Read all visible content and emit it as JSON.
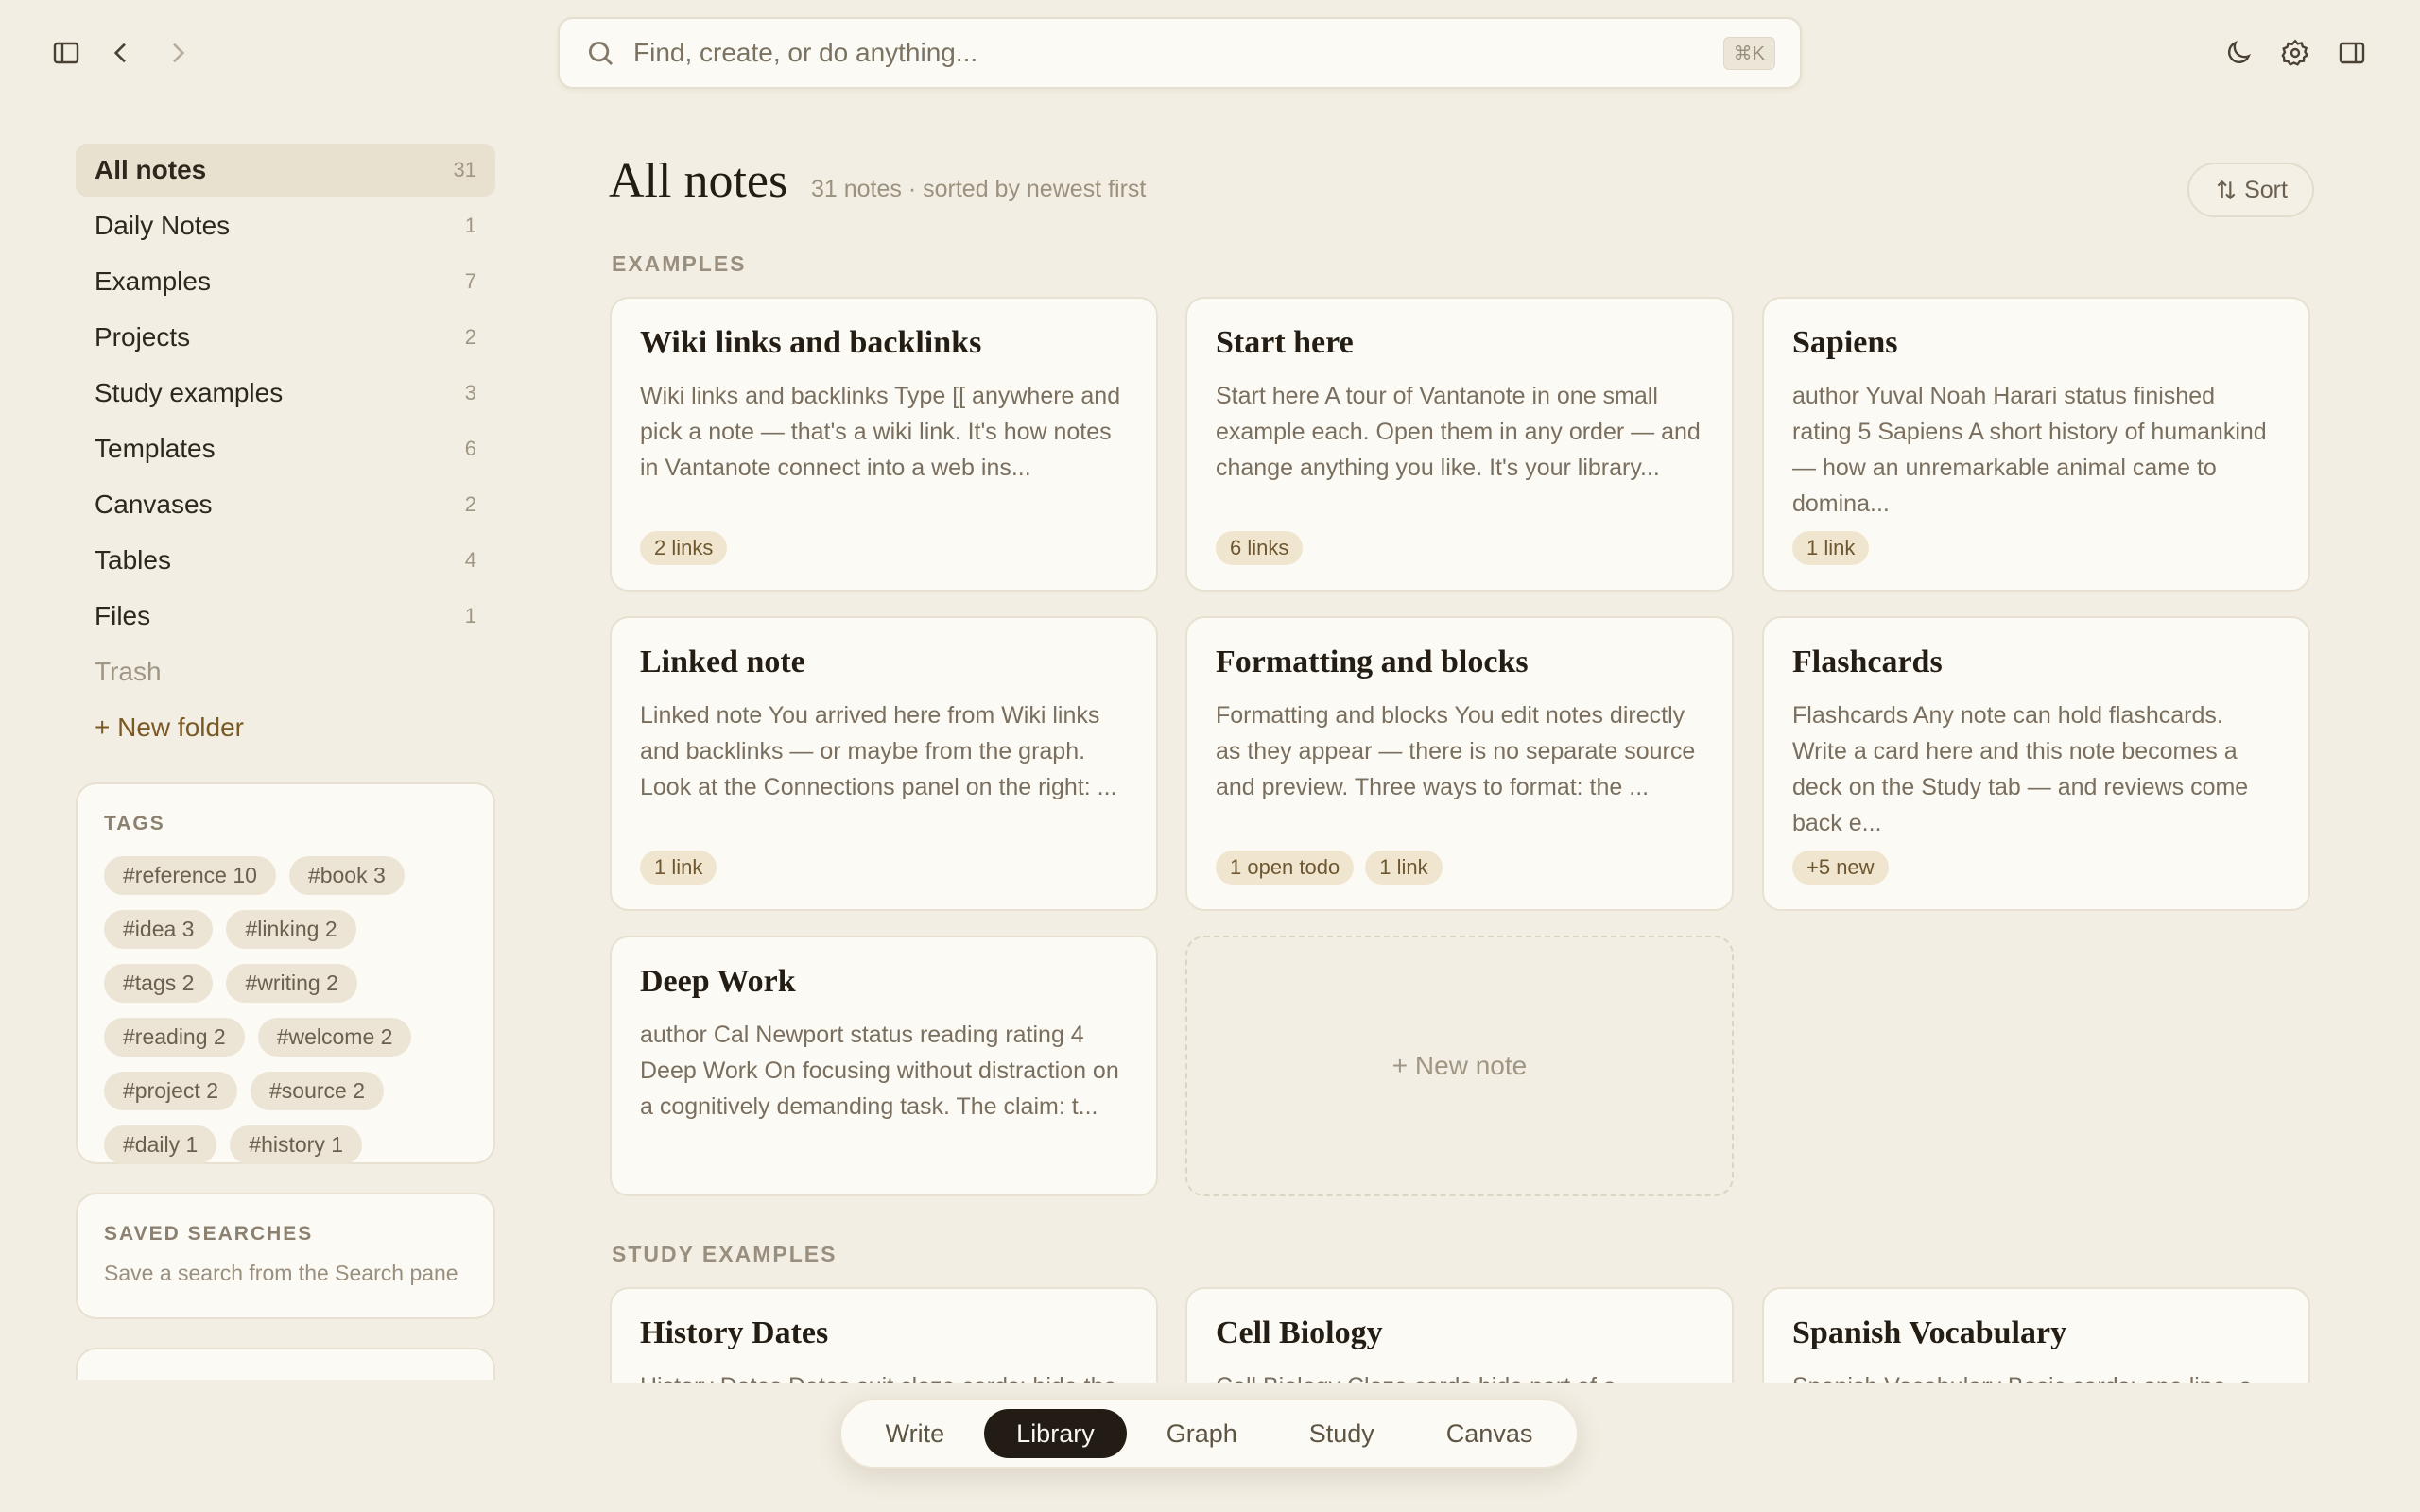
{
  "topbar": {
    "icons": [
      "sidebar-toggle-icon",
      "back-icon",
      "forward-icon",
      "moon-icon",
      "gear-icon",
      "right-panel-icon"
    ],
    "search_placeholder": "Find, create, or do anything...",
    "search_shortcut": "⌘K"
  },
  "sidebar": {
    "items": [
      {
        "label": "All notes",
        "count": "31"
      },
      {
        "label": "Daily Notes",
        "count": "1"
      },
      {
        "label": "Examples",
        "count": "7"
      },
      {
        "label": "Projects",
        "count": "2"
      },
      {
        "label": "Study examples",
        "count": "3"
      },
      {
        "label": "Templates",
        "count": "6"
      },
      {
        "label": "Canvases",
        "count": "2"
      },
      {
        "label": "Tables",
        "count": "4"
      },
      {
        "label": "Files",
        "count": "1"
      }
    ],
    "trash_label": "Trash",
    "new_folder_label": "+ New folder",
    "tags_title": "TAGS",
    "tags": [
      "#reference 10",
      "#book 3",
      "#idea 3",
      "#linking 2",
      "#tags 2",
      "#writing 2",
      "#reading 2",
      "#welcome 2",
      "#project 2",
      "#source 2",
      "#daily 1",
      "#history 1"
    ],
    "saved_title": "SAVED SEARCHES",
    "saved_empty": "Save a search from the Search pane"
  },
  "main": {
    "title": "All notes",
    "subtitle": "31 notes · sorted by newest first",
    "sort_label": "Sort",
    "section_examples": "EXAMPLES",
    "section_study": "STUDY EXAMPLES",
    "new_note_label": "+ New note",
    "cards": [
      {
        "title": "Wiki links and backlinks",
        "excerpt": "Wiki links and backlinks Type [[ anywhere and pick a note — that's a wiki link. It's how notes in Vantanote connect into a web ins...",
        "badges": [
          "2 links"
        ]
      },
      {
        "title": "Start here",
        "excerpt": "Start here A tour of Vantanote in one small example each. Open them in any order — and change anything you like. It's your library...",
        "badges": [
          "6 links"
        ]
      },
      {
        "title": "Sapiens",
        "excerpt": "author Yuval Noah Harari status finished rating 5 Sapiens A short history of humankind — how an unremarkable animal came to domina...",
        "badges": [
          "1 link"
        ]
      },
      {
        "title": "Linked note",
        "excerpt": "Linked note You arrived here from Wiki links and backlinks — or maybe from the graph. Look at the Connections panel on the right: ...",
        "badges": [
          "1 link"
        ]
      },
      {
        "title": "Formatting and blocks",
        "excerpt": "Formatting and blocks You edit notes directly as they appear — there is no separate source and preview. Three ways to format: the ...",
        "badges": [
          "1 open todo",
          "1 link"
        ]
      },
      {
        "title": "Flashcards",
        "excerpt": "Flashcards Any note can hold flashcards. Write a card here and this note becomes a deck on the Study tab — and reviews come back e...",
        "badges": [
          "+5 new"
        ]
      },
      {
        "title": "Deep Work",
        "excerpt": "author Cal Newport status reading rating 4 Deep Work On focusing without distraction on a cognitively demanding task. The claim: t...",
        "badges": []
      }
    ],
    "study_cards": [
      {
        "title": "History Dates",
        "excerpt": "History Dates Dates suit cloze cards: hide the"
      },
      {
        "title": "Cell Biology",
        "excerpt": "Cell Biology Cloze cards hide part of a"
      },
      {
        "title": "Spanish Vocabulary",
        "excerpt": "Spanish Vocabulary Basic cards: one line, a"
      }
    ]
  },
  "tabs": [
    "Write",
    "Library",
    "Graph",
    "Study",
    "Canvas"
  ],
  "active_tab": "Library"
}
